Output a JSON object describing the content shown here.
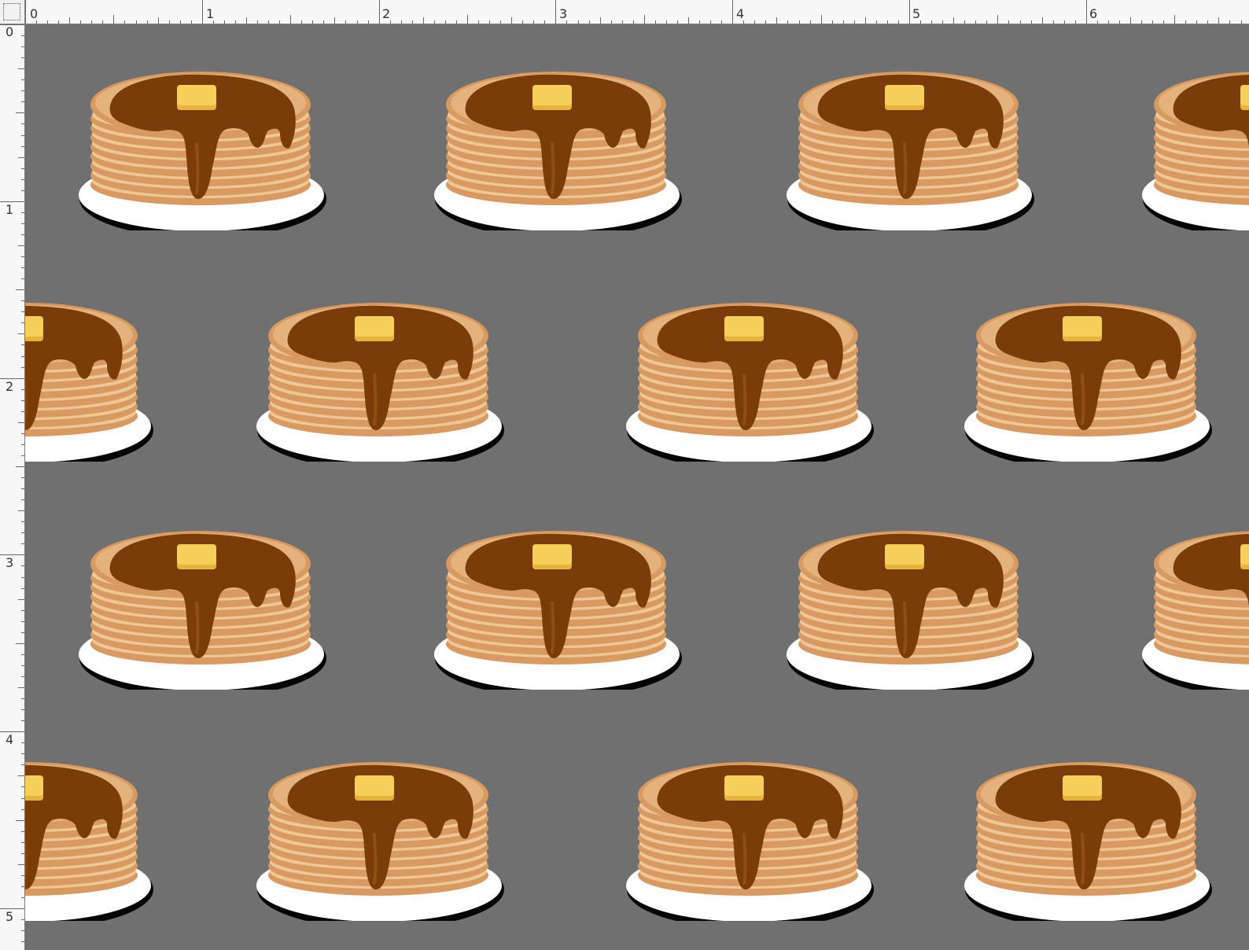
{
  "ruler": {
    "top_labels": [
      "0",
      "1",
      "2",
      "3",
      "4",
      "5",
      "6"
    ],
    "left_labels": [
      "0",
      "1",
      "2",
      "3",
      "4",
      "5"
    ]
  },
  "canvas": {
    "background": "#707070",
    "pattern_item": "pancake-stack-with-syrup-and-butter"
  },
  "colors": {
    "syrup": "#7a3d0a",
    "butter": "#f6cf5a",
    "pancake_dark": "#d89a60",
    "pancake_light": "#efc796",
    "plate": "#ffffff",
    "plate_shadow": "#050505"
  }
}
